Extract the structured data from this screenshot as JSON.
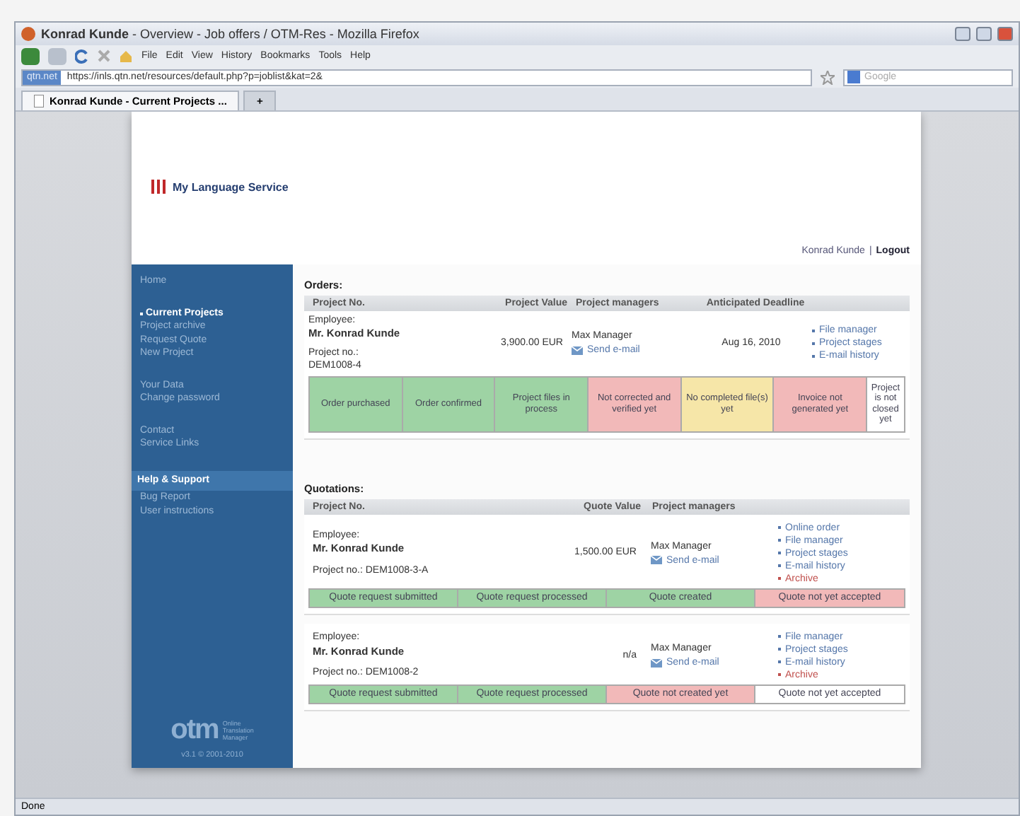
{
  "window": {
    "title_bold": "Konrad Kunde",
    "title": " - Overview - Job offers / OTM-Res - Mozilla Firefox"
  },
  "menu": [
    "File",
    "Edit",
    "View",
    "History",
    "Bookmarks",
    "Tools",
    "Help"
  ],
  "address": {
    "site": "qtn.net",
    "url": "https://inls.qtn.net/resources/default.php?p=joblist&kat=2&"
  },
  "search": {
    "placeholder": "Google"
  },
  "tabs": [
    {
      "label": "Konrad Kunde - Current Projects ...",
      "selected": true
    }
  ],
  "new_tab": "+",
  "brand": "My Language Service",
  "user": {
    "name": "Konrad Kunde",
    "separator": "|",
    "logout": "Logout"
  },
  "sidebar": {
    "groups": [
      [
        {
          "label": "Home",
          "kind": "link",
          "selected": false
        }
      ],
      [
        {
          "label": "Current Projects",
          "kind": "link",
          "selected": true
        },
        {
          "label": "Project archive",
          "kind": "link",
          "selected": false
        },
        {
          "label": "Request Quote",
          "kind": "link",
          "selected": false
        },
        {
          "label": "New Project",
          "kind": "link",
          "selected": false
        }
      ],
      [
        {
          "label": "Your Data",
          "kind": "link",
          "selected": false
        },
        {
          "label": "Change password",
          "kind": "link",
          "selected": false
        }
      ],
      [
        {
          "label": "Contact",
          "kind": "link",
          "selected": false
        },
        {
          "label": "Service Links",
          "kind": "link",
          "selected": false
        }
      ],
      [
        {
          "label": "Help & Support",
          "kind": "heading",
          "selected": false
        },
        {
          "label": "Bug Report",
          "kind": "link",
          "selected": false
        },
        {
          "label": "User instructions",
          "kind": "link",
          "selected": false
        }
      ]
    ],
    "logo": "otm",
    "logo_caption": "Online Translation Manager",
    "version": "v3.1  © 2001-2010"
  },
  "orders": {
    "title": "Orders:",
    "columns": [
      "Project No.",
      "Project Value",
      "Project managers",
      "Anticipated Deadline"
    ],
    "rows": [
      {
        "employee_label": "Employee:",
        "employee": "Mr. Konrad Kunde",
        "project_label": "Project no.:",
        "project_no": "DEM1008-4",
        "value": "3,900.00 EUR",
        "manager": "Max Manager",
        "email": "Send e-mail",
        "deadline": "Aug 16, 2010",
        "actions": [
          {
            "label": "File manager",
            "color": "#5577aa"
          },
          {
            "label": "Project stages",
            "color": "#5577aa"
          },
          {
            "label": "E-mail history",
            "color": "#5577aa"
          }
        ],
        "stages": [
          {
            "label": "Order purchased",
            "color": "#9ed3a4"
          },
          {
            "label": "Order confirmed",
            "color": "#9ed3a4"
          },
          {
            "label": "Project files in process",
            "color": "#9ed3a4"
          },
          {
            "label": "Not corrected and verified yet",
            "color": "#f2b9b9"
          },
          {
            "label": "No completed file(s) yet",
            "color": "#f6e6a8"
          },
          {
            "label": "Invoice not generated yet",
            "color": "#f2b9b9"
          },
          {
            "label": "Project is not closed yet",
            "color": "#ffffff"
          }
        ]
      }
    ]
  },
  "quotations": {
    "title": "Quotations:",
    "columns": [
      "Project No.",
      "Quote Value",
      "Project managers"
    ],
    "rows": [
      {
        "employee_label": "Employee:",
        "employee": "Mr. Konrad Kunde",
        "project": "Project no.: DEM1008-3-A",
        "value": "1,500.00 EUR",
        "manager": "Max Manager",
        "email": "Send e-mail",
        "actions": [
          {
            "label": "Online order",
            "color": "#5577aa"
          },
          {
            "label": "File manager",
            "color": "#5577aa"
          },
          {
            "label": "Project stages",
            "color": "#5577aa"
          },
          {
            "label": "E-mail history",
            "color": "#5577aa"
          },
          {
            "label": "Archive",
            "color": "#c0504d"
          }
        ],
        "stages": [
          {
            "label": "Quote request submitted",
            "color": "#9ed3a4"
          },
          {
            "label": "Quote request processed",
            "color": "#9ed3a4"
          },
          {
            "label": "Quote created",
            "color": "#9ed3a4"
          },
          {
            "label": "Quote not yet accepted",
            "color": "#f2b9b9"
          }
        ]
      },
      {
        "employee_label": "Employee:",
        "employee": "Mr. Konrad Kunde",
        "project": "Project no.: DEM1008-2",
        "value": "n/a",
        "manager": "Max Manager",
        "email": "Send e-mail",
        "actions": [
          {
            "label": "File manager",
            "color": "#5577aa"
          },
          {
            "label": "Project stages",
            "color": "#5577aa"
          },
          {
            "label": "E-mail history",
            "color": "#5577aa"
          },
          {
            "label": "Archive",
            "color": "#c0504d"
          }
        ],
        "stages": [
          {
            "label": "Quote request submitted",
            "color": "#9ed3a4"
          },
          {
            "label": "Quote request processed",
            "color": "#9ed3a4"
          },
          {
            "label": "Quote not created yet",
            "color": "#f2b9b9"
          },
          {
            "label": "Quote not yet accepted",
            "color": "#ffffff"
          }
        ]
      }
    ]
  },
  "status_bar": "Done"
}
